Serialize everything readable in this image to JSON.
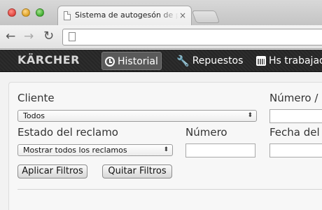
{
  "browser": {
    "tab_title": "Sistema de autogesón de p",
    "tab_close": "×",
    "back_glyph": "←",
    "forward_glyph": "→",
    "reload_glyph": "↻"
  },
  "header": {
    "logo_text": "KÄRCHER",
    "menu": [
      {
        "label": "Historial",
        "icon": "clock-icon"
      },
      {
        "label": "Repuestos",
        "icon": "wrench-icon"
      },
      {
        "label": "Hs trabajad",
        "icon": "calendar-icon"
      }
    ]
  },
  "filters": {
    "cliente_label": "Cliente",
    "cliente_value": "Todos",
    "numero_truncated_label": "Número /",
    "estado_label": "Estado del reclamo",
    "estado_value": "Mostrar todos los reclamos",
    "numero_label": "Número",
    "numero_value": "",
    "fecha_label": "Fecha del",
    "fecha_value": "",
    "apply_button": "Aplicar Filtros",
    "clear_button": "Quitar Filtros"
  },
  "colors": {
    "header_bg": "#262626",
    "active_menu_bg": "#5a5a5a"
  }
}
